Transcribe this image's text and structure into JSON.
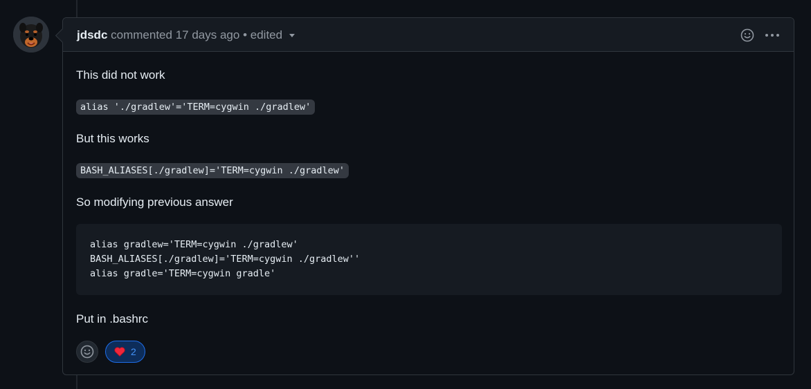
{
  "comment": {
    "author": "jdsdc",
    "action": "commented",
    "time": "17 days ago",
    "separator": "•",
    "edited": "edited"
  },
  "body": {
    "p1": "This did not work",
    "code1": "alias './gradlew'='TERM=cygwin ./gradlew'",
    "p2": "But this works",
    "code2": "BASH_ALIASES[./gradlew]='TERM=cygwin ./gradlew'",
    "p3": "So modifying previous answer",
    "code_block": [
      "alias gradlew='TERM=cygwin ./gradlew'",
      "BASH_ALIASES[./gradlew]='TERM=cygwin ./gradlew''",
      "alias gradle='TERM=cygwin gradle'"
    ],
    "p4": "Put in .bashrc"
  },
  "reactions": {
    "heart_count": "2",
    "heart_icon": "red-heart-emoji",
    "add_icon": "smiley-icon"
  },
  "header_icons": [
    "smiley-icon",
    "kebab-icon"
  ]
}
